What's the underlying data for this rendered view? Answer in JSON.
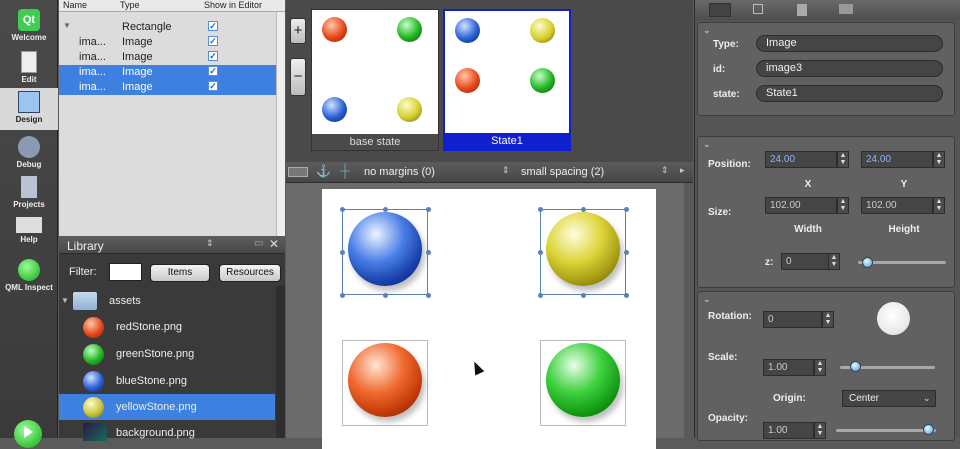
{
  "modes": [
    {
      "label": "Welcome"
    },
    {
      "label": "Edit"
    },
    {
      "label": "Design"
    },
    {
      "label": "Debug"
    },
    {
      "label": "Projects"
    },
    {
      "label": "Help"
    },
    {
      "label": "QML Inspect"
    }
  ],
  "navigator": {
    "columns": {
      "name": "Name",
      "type": "Type",
      "show": "Show in Editor"
    },
    "rows": [
      {
        "name": "",
        "type": "Rectangle"
      },
      {
        "name": "ima...",
        "type": "Image"
      },
      {
        "name": "ima...",
        "type": "Image"
      },
      {
        "name": "ima...",
        "type": "Image"
      },
      {
        "name": "ima...",
        "type": "Image"
      }
    ]
  },
  "library": {
    "title": "Library",
    "filter_label": "Filter:",
    "items_tab": "Items",
    "resources_tab": "Resources",
    "folder": "assets",
    "files": [
      {
        "name": "redStone.png",
        "color": "#e8471a"
      },
      {
        "name": "greenStone.png",
        "color": "#22b522"
      },
      {
        "name": "blueStone.png",
        "color": "#2a5fd6"
      },
      {
        "name": "yellowStone.png",
        "color": "#c8c43a"
      },
      {
        "name": "background.png",
        "color": "#3a2a5a"
      }
    ]
  },
  "states": [
    {
      "name": "base state"
    },
    {
      "name": "State1"
    }
  ],
  "toolbar": {
    "margins": "no margins (0)",
    "spacing": "small spacing (2)"
  },
  "colors": {
    "red": "#e8471a",
    "green": "#22b522",
    "blue": "#2a5fd6",
    "yellow": "#d6cf2a",
    "selection": "#3d80df",
    "state_active": "#1020d0"
  },
  "properties": {
    "type_label": "Type:",
    "type_value": "Image",
    "id_label": "id:",
    "id_value": "image3",
    "state_label": "state:",
    "state_value": "State1",
    "position_label": "Position:",
    "pos_x": "24.00",
    "pos_y": "24.00",
    "x_label": "X",
    "y_label": "Y",
    "size_label": "Size:",
    "width": "102.00",
    "height": "102.00",
    "width_label": "Width",
    "height_label": "Height",
    "z_label": "z:",
    "z_value": "0",
    "rotation_label": "Rotation:",
    "rotation_value": "0",
    "scale_label": "Scale:",
    "scale_value": "1.00",
    "origin_label": "Origin:",
    "origin_value": "Center",
    "opacity_label": "Opacity:",
    "opacity_value": "1.00"
  }
}
